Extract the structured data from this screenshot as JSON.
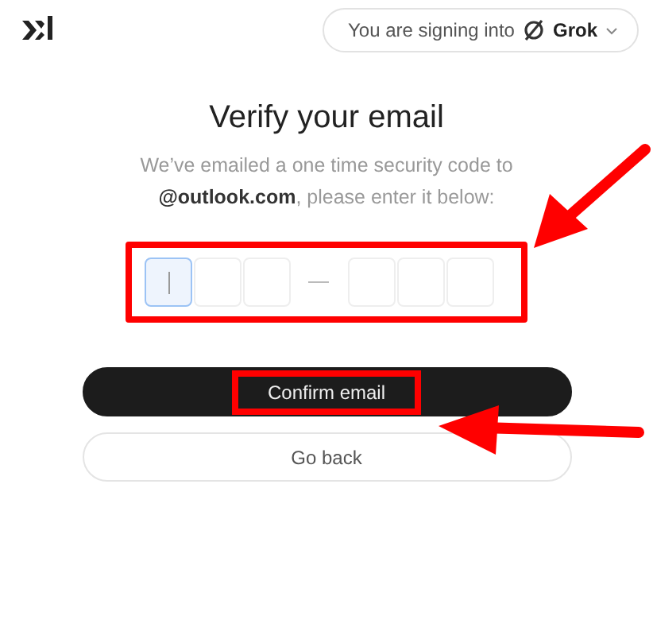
{
  "header": {
    "signing_label": "You are signing into",
    "app_name": "Grok"
  },
  "title": "Verify your email",
  "message": "We’ve emailed a one time security code to **@outlook.com**, please enter it below:",
  "code_fields": [
    {
      "focused": true
    },
    {
      "focused": false
    },
    {
      "focused": false
    },
    {
      "focused": false
    },
    {
      "focused": false
    },
    {
      "focused": false
    }
  ],
  "buttons": [
    {
      "kind": "primary",
      "label": "Confirm email",
      "highlighted": true
    },
    {
      "kind": "secondary",
      "label": "Go back",
      "highlighted": false
    }
  ]
}
